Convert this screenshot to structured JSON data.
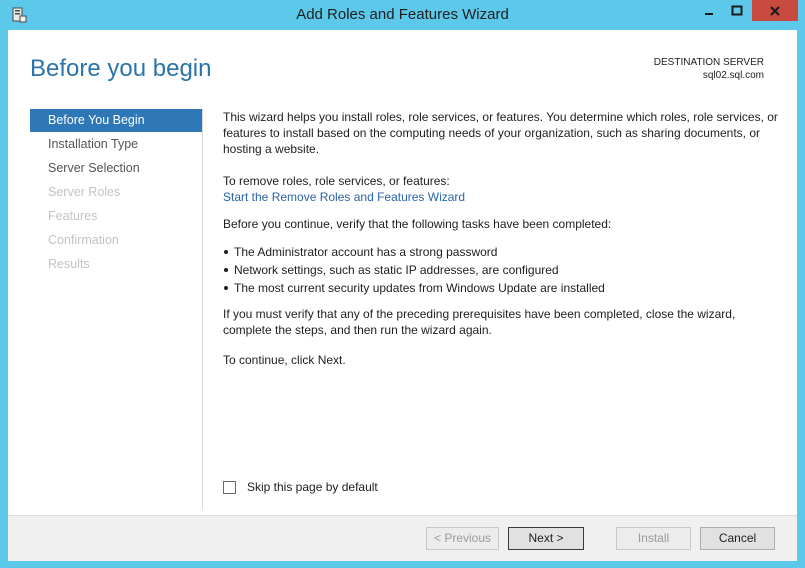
{
  "window": {
    "title": "Add Roles and Features Wizard",
    "colors": {
      "frame": "#5cc8ea",
      "close": "#c74b3e",
      "accent": "#2e78b8",
      "heading": "#2b74a8",
      "link": "#2a63a8"
    }
  },
  "header": {
    "heading": "Before you begin",
    "destination_label": "DESTINATION SERVER",
    "destination_server": "sql02.sql.com"
  },
  "nav": {
    "items": [
      {
        "label": "Before You Begin",
        "state": "active"
      },
      {
        "label": "Installation Type",
        "state": "enabled"
      },
      {
        "label": "Server Selection",
        "state": "enabled"
      },
      {
        "label": "Server Roles",
        "state": "disabled"
      },
      {
        "label": "Features",
        "state": "disabled"
      },
      {
        "label": "Confirmation",
        "state": "disabled"
      },
      {
        "label": "Results",
        "state": "disabled"
      }
    ]
  },
  "content": {
    "intro": "This wizard helps you install roles, role services, or features. You determine which roles, role services, or features to install based on the computing needs of your organization, such as sharing documents, or hosting a website.",
    "remove_text": "To remove roles, role services, or features:",
    "remove_link": "Start the Remove Roles and Features Wizard",
    "verify_text": "Before you continue, verify that the following tasks have been completed:",
    "bullets": [
      "The Administrator account has a strong password",
      "Network settings, such as static IP addresses, are configured",
      "The most current security updates from Windows Update are installed"
    ],
    "prereq_text": "If you must verify that any of the preceding prerequisites have been completed, close the wizard, complete the steps, and then run the wizard again.",
    "continue_text": "To continue, click Next."
  },
  "skip_label": "Skip this page by default",
  "footer": {
    "previous": "< Previous",
    "next": "Next >",
    "install": "Install",
    "cancel": "Cancel"
  },
  "icons": {
    "app": "server-manager-icon",
    "minimize": "minimize-icon",
    "maximize": "maximize-icon",
    "close": "close-icon"
  }
}
